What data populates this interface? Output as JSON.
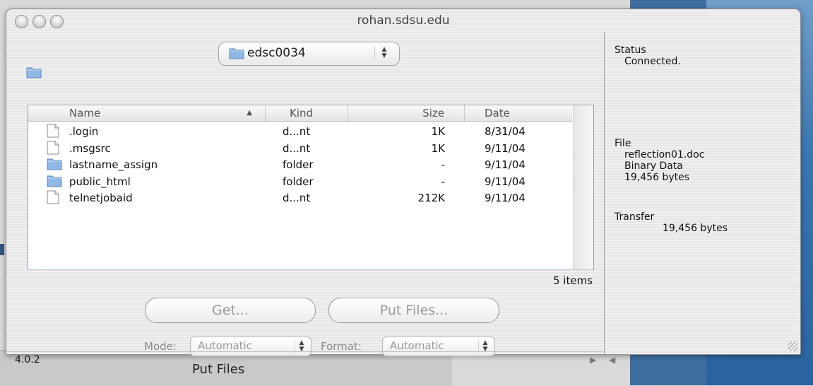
{
  "window": {
    "title": "rohan.sdsu.edu"
  },
  "path_popup": {
    "value": "edsc0034"
  },
  "list": {
    "columns": [
      "Name",
      "Kind",
      "Size",
      "Date"
    ],
    "rows": [
      {
        "name": ".login",
        "kind": "d...nt",
        "size": "1K",
        "date": "8/31/04",
        "icon": "document-icon"
      },
      {
        "name": ".msgsrc",
        "kind": "d...nt",
        "size": "1K",
        "date": "9/11/04",
        "icon": "document-icon"
      },
      {
        "name": "lastname_assign",
        "kind": "folder",
        "size": "-",
        "date": "9/11/04",
        "icon": "folder-icon"
      },
      {
        "name": "public_html",
        "kind": "folder",
        "size": "-",
        "date": "9/11/04",
        "icon": "folder-icon"
      },
      {
        "name": "telnetjobaid",
        "kind": "d...nt",
        "size": "212K",
        "date": "9/11/04",
        "icon": "document-icon"
      }
    ],
    "item_count": "5 items"
  },
  "buttons": {
    "get": "Get...",
    "put": "Put Files..."
  },
  "mode": {
    "label": "Mode:",
    "value": "Automatic"
  },
  "format": {
    "label": "Format:",
    "value": "Automatic"
  },
  "version": "4.0.2",
  "status": {
    "heading": "Status",
    "value": "Connected."
  },
  "file": {
    "heading": "File",
    "name": "reflection01.doc",
    "type": "Binary Data",
    "size": "19,456 bytes"
  },
  "transfer": {
    "heading": "Transfer",
    "value": "19,456 bytes"
  },
  "background_window": {
    "label": "Put Files"
  },
  "colors": {
    "folder": "#8fb8e6",
    "window_bg": "#ececec"
  }
}
